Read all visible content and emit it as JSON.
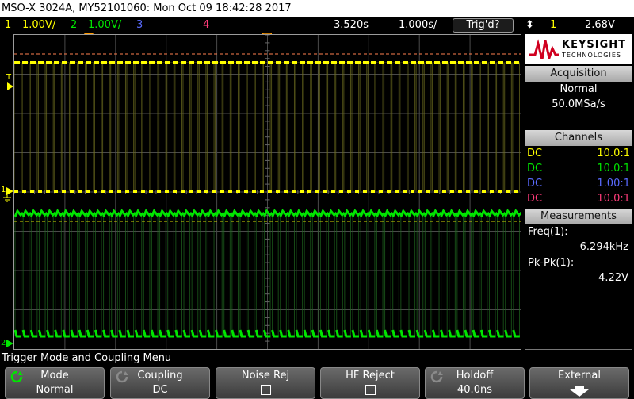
{
  "title": "MSO-X 3024A, MY52101060: Mon Oct 09 18:42:28 2017",
  "status": {
    "ch1_num": "1",
    "ch1_scale": "1.00V/",
    "ch2_num": "2",
    "ch2_scale": "1.00V/",
    "ch3_num": "3",
    "ch4_num": "4",
    "time_pos": "3.520s",
    "time_div": "1.000s/",
    "trig_state": "Trig'd?",
    "trig_slope_symbol": "⬍",
    "trig_source": "1",
    "trig_level": "2.68V"
  },
  "colors": {
    "ch1": "#ffff00",
    "ch2": "#00e600",
    "ch3": "#5a6bff",
    "ch4": "#ff3c7a",
    "grid": "#4a4a4a",
    "trigger_marker": "#ff9900",
    "ref_dashed": "#ff7f50"
  },
  "markers": {
    "ch1_ground": "1",
    "ch2_ground": "2",
    "trigger_level": "T"
  },
  "logo": {
    "line1": "KEYSIGHT",
    "line2": "TECHNOLOGIES",
    "icon": "keysight-wave-logo"
  },
  "acquisition": {
    "header": "Acquisition",
    "mode": "Normal",
    "rate": "50.0MSa/s"
  },
  "channels": {
    "header": "Channels",
    "rows": [
      {
        "coupling": "DC",
        "probe": "10.0:1"
      },
      {
        "coupling": "DC",
        "probe": "10.0:1"
      },
      {
        "coupling": "DC",
        "probe": "1.00:1"
      },
      {
        "coupling": "DC",
        "probe": "10.0:1"
      }
    ]
  },
  "measurements": {
    "header": "Measurements",
    "items": [
      {
        "label": "Freq(1):",
        "value": "6.294kHz"
      },
      {
        "label": "Pk-Pk(1):",
        "value": "4.22V"
      }
    ]
  },
  "menu_title": "Trigger Mode and Coupling Menu",
  "softkeys": [
    {
      "top": "Mode",
      "bottom": "Normal",
      "icon": "rotate-knob-icon"
    },
    {
      "top": "Coupling",
      "bottom": "DC",
      "icon": "rotate-knob-icon"
    },
    {
      "top": "Noise Rej",
      "bottom": "",
      "icon": "checkbox-icon"
    },
    {
      "top": "HF Reject",
      "bottom": "",
      "icon": "checkbox-icon"
    },
    {
      "top": "Holdoff",
      "bottom": "40.0ns",
      "icon": "rotate-knob-icon"
    },
    {
      "top": "External",
      "bottom": "",
      "icon": "down-arrow-icon"
    }
  ]
}
